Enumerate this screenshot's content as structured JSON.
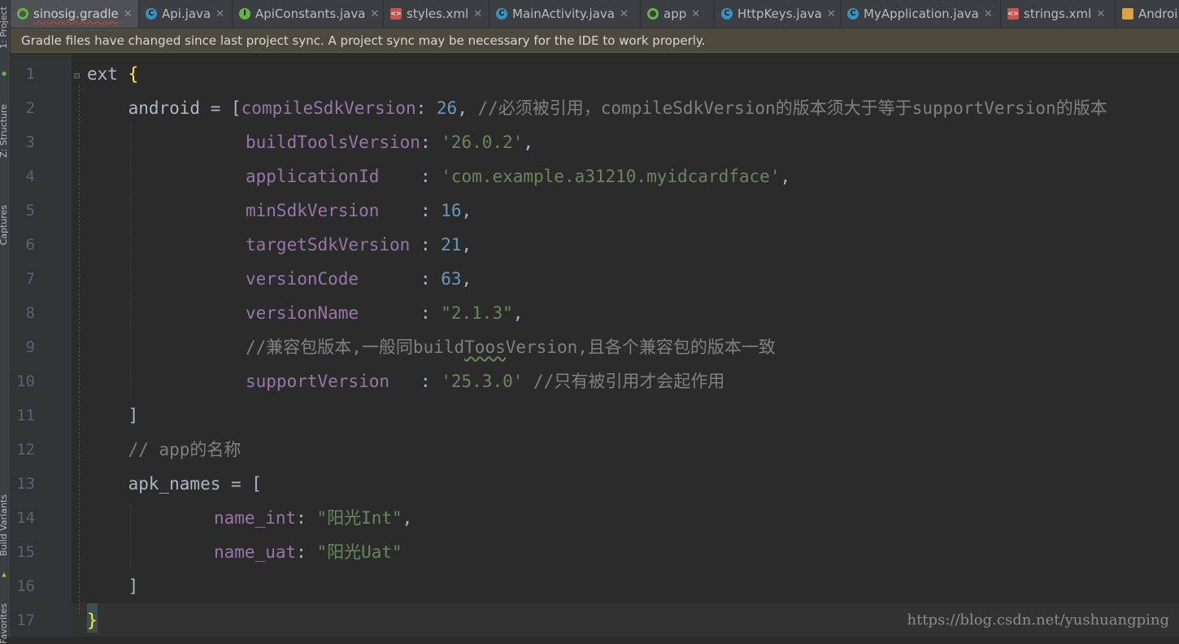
{
  "tabs": [
    {
      "label": "sinosig.gradle",
      "icon": "gradle-icon",
      "active": true
    },
    {
      "label": "Api.java",
      "icon": "class-icon"
    },
    {
      "label": "ApiConstants.java",
      "icon": "interface-icon"
    },
    {
      "label": "styles.xml",
      "icon": "xml-icon"
    },
    {
      "label": "MainActivity.java",
      "icon": "class-icon"
    },
    {
      "label": "app",
      "icon": "gradle-icon"
    },
    {
      "label": "HttpKeys.java",
      "icon": "class-icon"
    },
    {
      "label": "MyApplication.java",
      "icon": "class-icon"
    },
    {
      "label": "strings.xml",
      "icon": "xml-icon"
    },
    {
      "label": "Androi",
      "icon": "manifest-icon"
    }
  ],
  "banner": "Gradle files have changed since last project sync. A project sync may be necessary for the IDE to work properly.",
  "sidebar": [
    "1: Project",
    "Z: Structure",
    "Captures",
    "Build Variants",
    "Favorites"
  ],
  "line_numbers": [
    "1",
    "2",
    "3",
    "4",
    "5",
    "6",
    "7",
    "8",
    "9",
    "10",
    "11",
    "12",
    "13",
    "14",
    "15",
    "16",
    "17"
  ],
  "code": {
    "l1_ext": "ext ",
    "l1_brace": "{",
    "l2_a": "    android = [",
    "l2_key": "compileSdkVersion",
    "l2_colon": ": ",
    "l2_num": "26",
    "l2_comma": ", ",
    "l2_cmt": "//必须被引用，compileSdkVersion的版本须大于等于supportVersion的版本",
    "l3_key": "buildToolsVersion",
    "l3_colon": ": ",
    "l3_str": "'26.0.2'",
    "l3_comma": ",",
    "l4_key": "applicationId    ",
    "l4_colon": ": ",
    "l4_str": "'com.example.a31210.myidcardface'",
    "l4_comma": ",",
    "l5_key": "minSdkVersion    ",
    "l5_colon": ": ",
    "l5_num": "16",
    "l5_comma": ",",
    "l6_key": "targetSdkVersion ",
    "l6_colon": ": ",
    "l6_num": "21",
    "l6_comma": ",",
    "l7_key": "versionCode      ",
    "l7_colon": ": ",
    "l7_num": "63",
    "l7_comma": ",",
    "l8_key": "versionName      ",
    "l8_colon": ": ",
    "l8_str": "\"2.1.3\"",
    "l8_comma": ",",
    "l9_cmt_a": "//兼容包版本,一般同build",
    "l9_cmt_b": "Toos",
    "l9_cmt_c": "Version,且各个兼容包的版本一致",
    "l10_key": "supportVersion   ",
    "l10_colon": ": ",
    "l10_str": "'25.3.0'",
    "l10_cmt": " //只有被引用才会起作用",
    "l11": "    ]",
    "l12": "    // app的名称",
    "l13": "    apk_names = [",
    "l14_key": "name_int",
    "l14_colon": ": ",
    "l14_str": "\"阳光Int\"",
    "l14_comma": ",",
    "l15_key": "name_uat",
    "l15_colon": ": ",
    "l15_str": "\"阳光Uat\"",
    "l16": "    ]",
    "l17": "}"
  },
  "watermark": "https://blog.csdn.net/yushuangping"
}
